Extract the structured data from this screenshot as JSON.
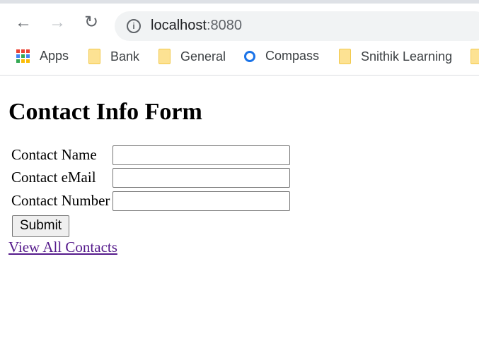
{
  "browser": {
    "url_host": "localhost",
    "url_port": ":8080",
    "bookmarks": [
      {
        "label": "Apps",
        "icon": "apps-grid-icon"
      },
      {
        "label": "Bank",
        "icon": "folder-icon"
      },
      {
        "label": "General",
        "icon": "folder-icon"
      },
      {
        "label": "Compass",
        "icon": "compass-icon"
      },
      {
        "label": "Snithik Learning",
        "icon": "folder-icon"
      }
    ]
  },
  "page": {
    "title": "Contact Info Form",
    "fields": [
      {
        "label": "Contact Name",
        "value": ""
      },
      {
        "label": "Contact eMail",
        "value": ""
      },
      {
        "label": "Contact Number",
        "value": ""
      }
    ],
    "submit_label": "Submit",
    "link_label": "View All Contacts"
  }
}
